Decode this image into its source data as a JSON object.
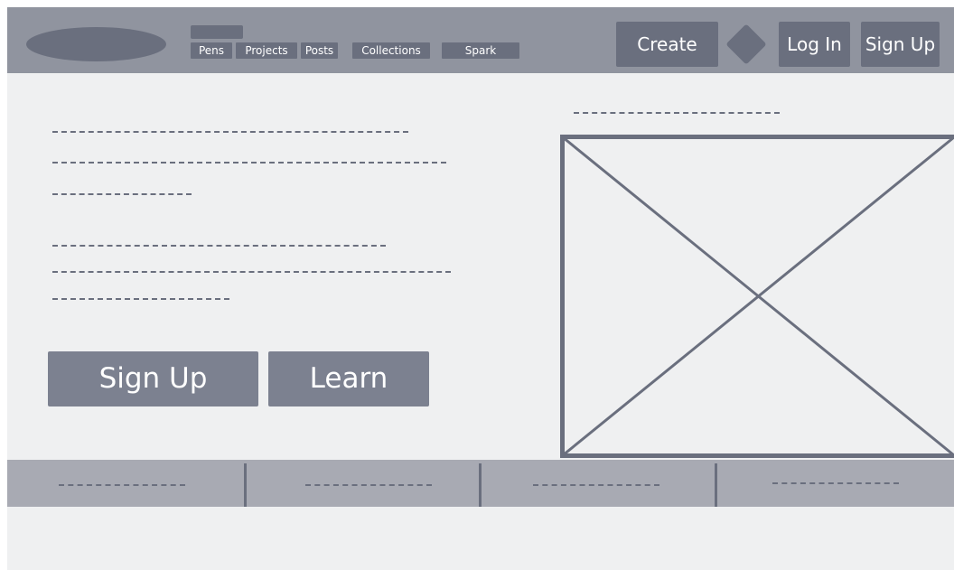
{
  "header": {
    "nav": [
      {
        "label": "Pens"
      },
      {
        "label": "Projects"
      },
      {
        "label": "Posts"
      },
      {
        "label": "Collections"
      },
      {
        "label": "Spark"
      }
    ],
    "create_label": "Create",
    "login_label": "Log In",
    "signup_label": "Sign Up"
  },
  "hero": {
    "signup_label": "Sign Up",
    "learn_label": "Learn"
  },
  "colors": {
    "header_bg": "#90949f",
    "button_bg": "#6a6f7e",
    "page_bg": "#eff0f1",
    "footer_bg": "#a8aab3"
  },
  "icons": {
    "logo": "logo-placeholder",
    "diamond": "diamond-icon",
    "image": "image-placeholder-icon"
  }
}
